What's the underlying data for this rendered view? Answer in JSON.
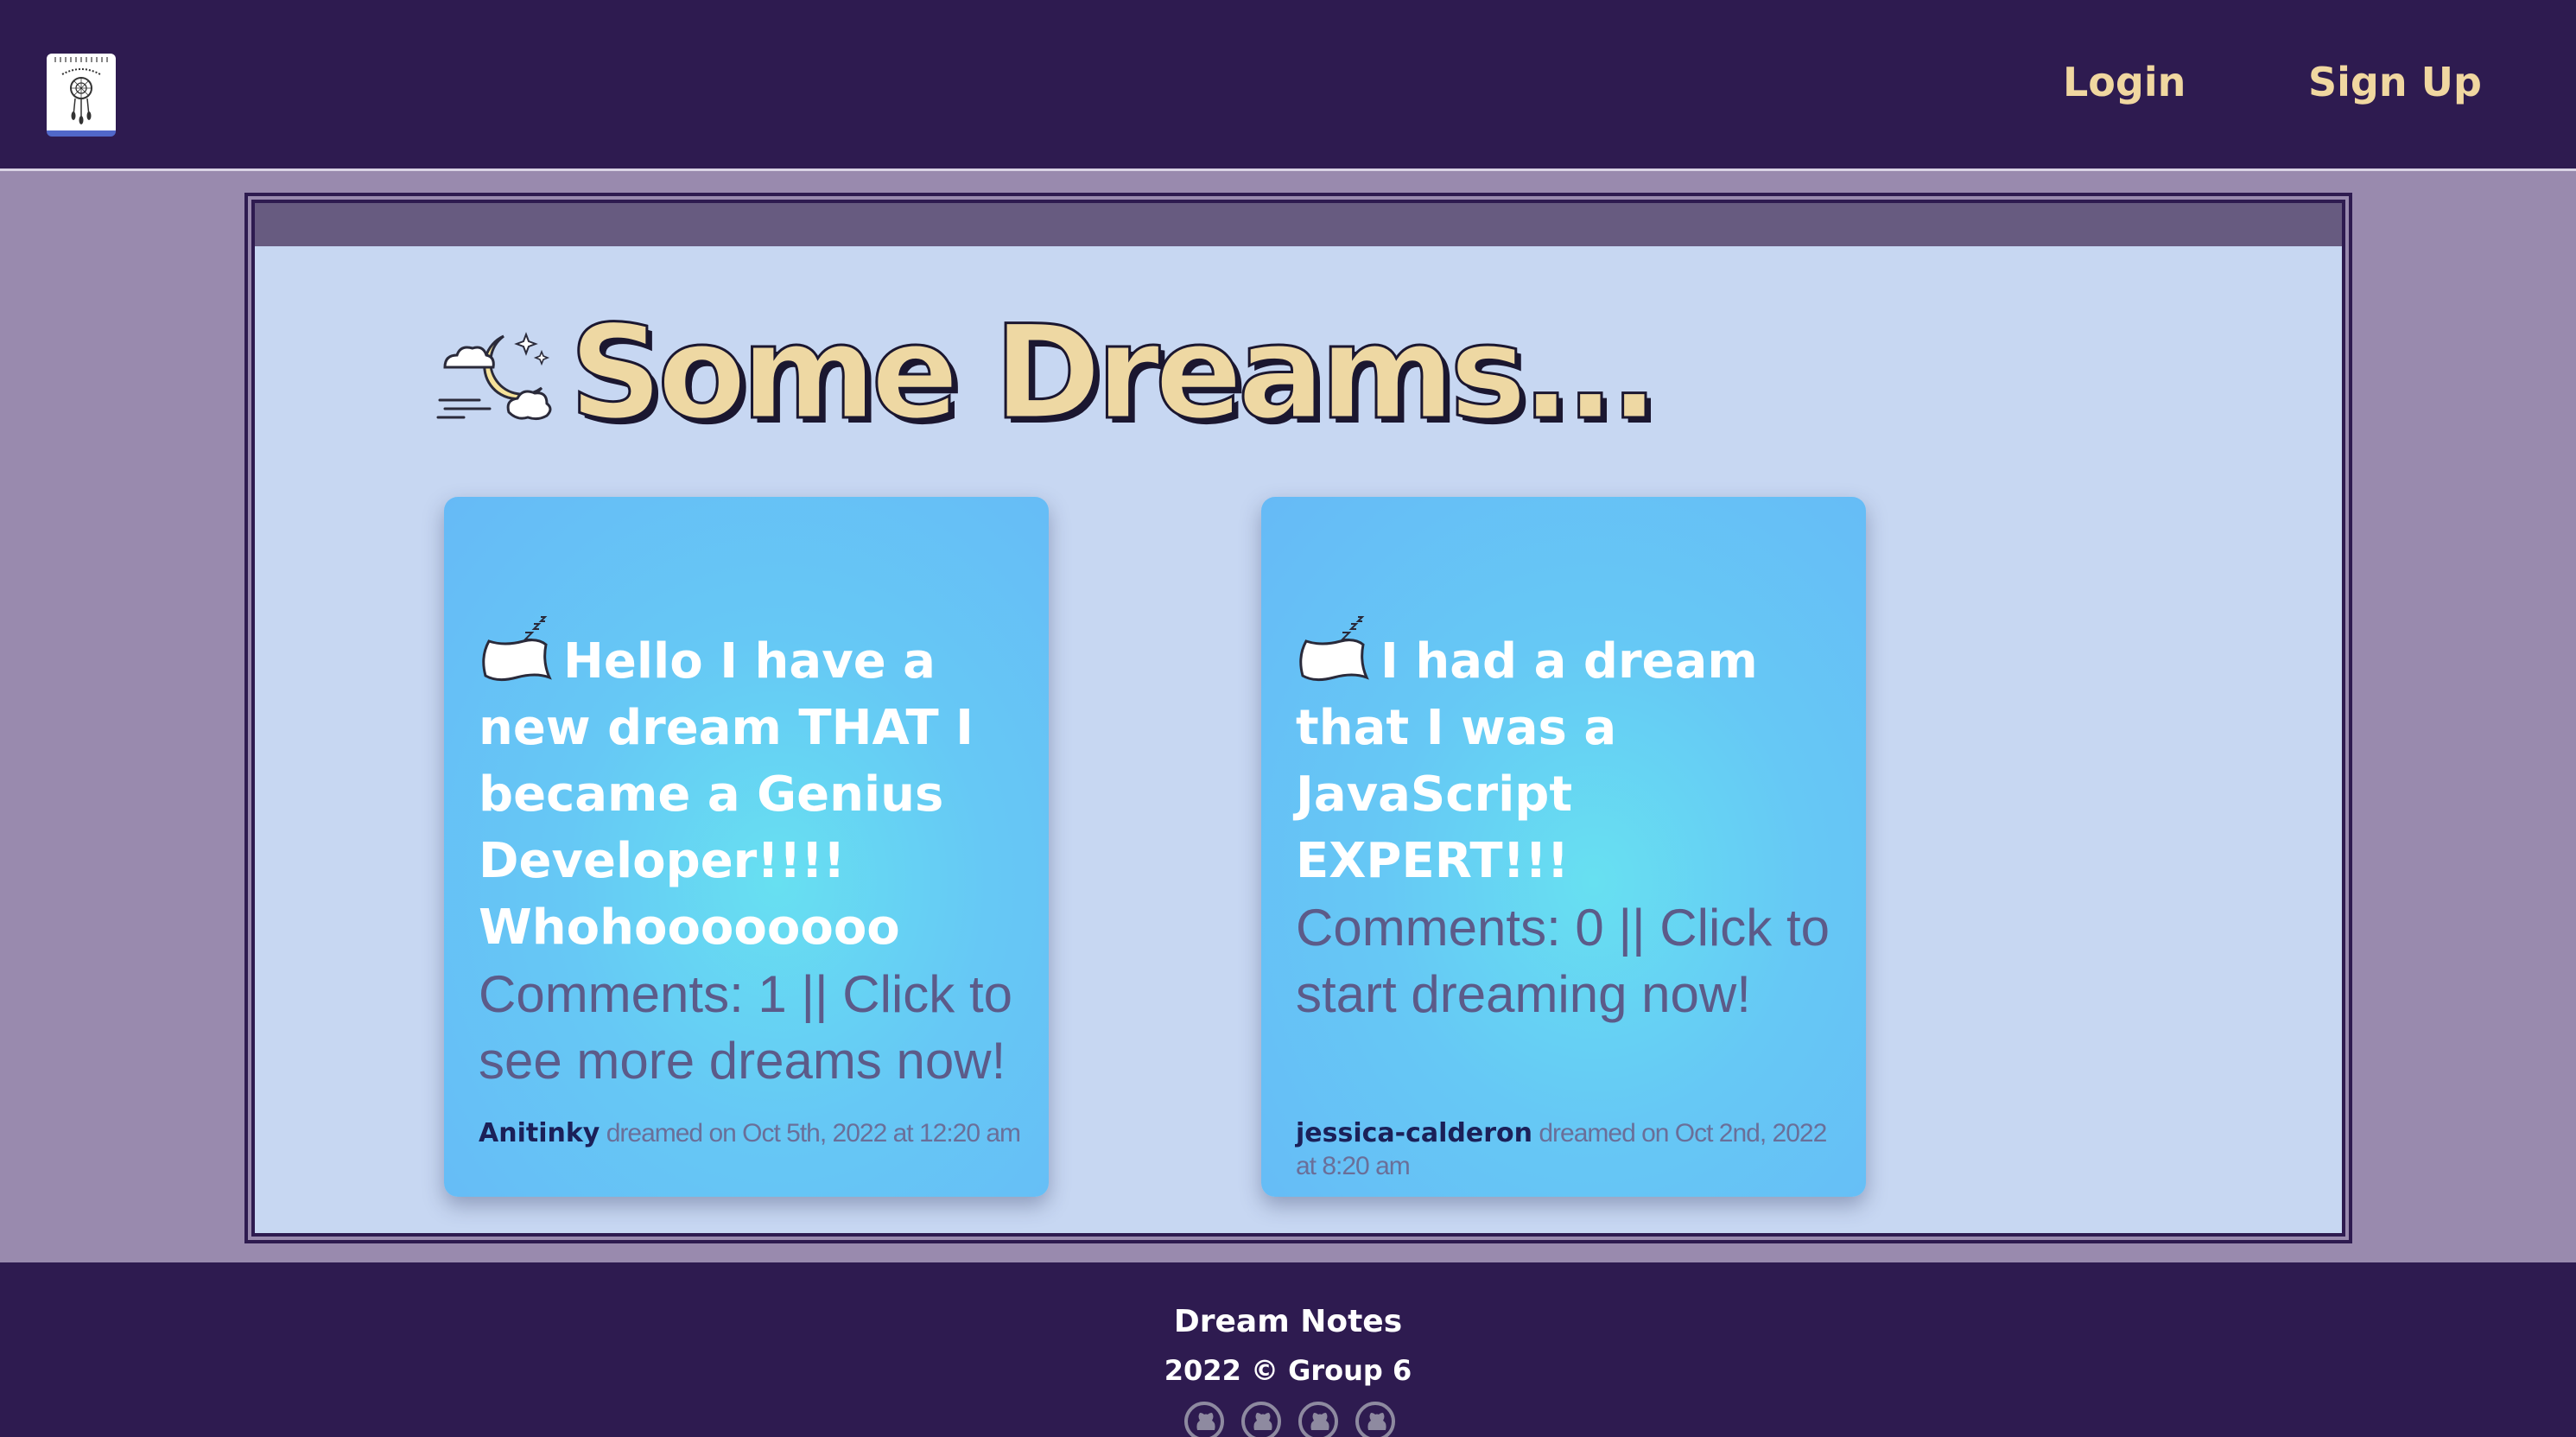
{
  "app": {
    "logo_icon": "dream-notes-notepad-logo"
  },
  "nav": {
    "login_label": "Login",
    "signup_label": "Sign Up"
  },
  "page": {
    "title": "Some Dreams...",
    "title_icon": "moon-clouds-icon"
  },
  "dreams": [
    {
      "title": "Hello I have a new dream THAT I became a Genius Developer!!!! Whohoooooooo",
      "comments_text": "Comments: 1 || Click to see more dreams now!",
      "author": "Anitinky",
      "meta": "dreamed on Oct 5th, 2022 at 12:20 am",
      "icon": "pillow-icon"
    },
    {
      "title": "I had a dream that I was a JavaScript EXPERT!!!",
      "comments_text": "Comments: 0 || Click to start dreaming now!",
      "author": "jessica-calderon",
      "meta": "dreamed on Oct 2nd, 2022 at 8:20 am",
      "icon": "pillow-icon"
    }
  ],
  "footer": {
    "name": "Dream Notes",
    "copyright": "2022 © Group 6",
    "icons": [
      "github-icon",
      "github-icon",
      "github-icon",
      "github-icon"
    ]
  },
  "colors": {
    "nav_bg": "#2e1b50",
    "page_bg": "#998aae",
    "panel_bg": "#c7d7f2",
    "panel_header": "#675b80",
    "accent_gold": "#f0d7a0",
    "card_blue": "#66baf6",
    "card_cyan": "#67e0f1"
  }
}
